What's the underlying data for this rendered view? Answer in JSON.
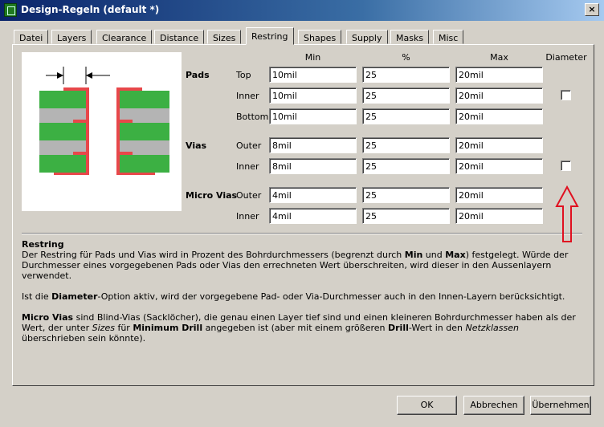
{
  "window": {
    "title": "Design-Regeln (default *)",
    "close_glyph": "×"
  },
  "tabs": [
    "Datei",
    "Layers",
    "Clearance",
    "Distance",
    "Sizes",
    "Restring",
    "Shapes",
    "Supply",
    "Masks",
    "Misc"
  ],
  "active_tab": "Restring",
  "columns": {
    "min": "Min",
    "pct": "%",
    "max": "Max",
    "diameter": "Diameter"
  },
  "groups": {
    "pads": {
      "label": "Pads",
      "rows": [
        {
          "label": "Top",
          "min": "10mil",
          "pct": "25",
          "max": "20mil"
        },
        {
          "label": "Inner",
          "min": "10mil",
          "pct": "25",
          "max": "20mil"
        },
        {
          "label": "Bottom",
          "min": "10mil",
          "pct": "25",
          "max": "20mil"
        }
      ],
      "diameter_checked": false
    },
    "vias": {
      "label": "Vias",
      "rows": [
        {
          "label": "Outer",
          "min": "8mil",
          "pct": "25",
          "max": "20mil"
        },
        {
          "label": "Inner",
          "min": "8mil",
          "pct": "25",
          "max": "20mil"
        }
      ],
      "diameter_checked": false
    },
    "micro_vias": {
      "label": "Micro Vias",
      "rows": [
        {
          "label": "Outer",
          "min": "4mil",
          "pct": "25",
          "max": "20mil"
        },
        {
          "label": "Inner",
          "min": "4mil",
          "pct": "25",
          "max": "20mil"
        }
      ]
    }
  },
  "help": {
    "heading": "Restring",
    "p1": [
      {
        "t": "Der Restring für Pads und Vias wird in Prozent des Bohrdurchmessers (begrenzt durch "
      },
      {
        "t": "Min",
        "b": true
      },
      {
        "t": " und "
      },
      {
        "t": "Max",
        "b": true
      },
      {
        "t": ") festgelegt. Würde der Durchmesser eines vorgegebenen Pads oder Vias den errechneten Wert überschreiten, wird dieser in den Aussenlayern verwendet."
      }
    ],
    "p2": [
      {
        "t": "Ist die "
      },
      {
        "t": "Diameter",
        "b": true
      },
      {
        "t": "-Option aktiv, wird der vorgegebene Pad- oder Via-Durchmesser auch in den Innen-Layern berücksichtigt."
      }
    ],
    "p3": [
      {
        "t": "Micro Vias",
        "b": true
      },
      {
        "t": " sind Blind-Vias (Sacklöcher), die genau einen Layer tief sind und einen kleineren Bohrdurchmesser haben als der Wert, der unter "
      },
      {
        "t": "Sizes",
        "i": true
      },
      {
        "t": " für "
      },
      {
        "t": "Minimum Drill",
        "b": true
      },
      {
        "t": " angegeben ist (aber mit einem größeren "
      },
      {
        "t": "Drill",
        "b": true
      },
      {
        "t": "-Wert in den "
      },
      {
        "t": "Netzklassen",
        "i": true
      },
      {
        "t": " überschrieben sein könnte)."
      }
    ]
  },
  "buttons": {
    "ok": "OK",
    "cancel": "Abbrechen",
    "apply": "Übernehmen"
  },
  "colors": {
    "copper": "#3cb043",
    "restring": "#e8474a",
    "drill_gap": "#b4b4b4",
    "annotation_arrow": "#e01020"
  },
  "icons": {
    "app": "eagle-app-icon",
    "annotation": "red-up-arrow"
  }
}
